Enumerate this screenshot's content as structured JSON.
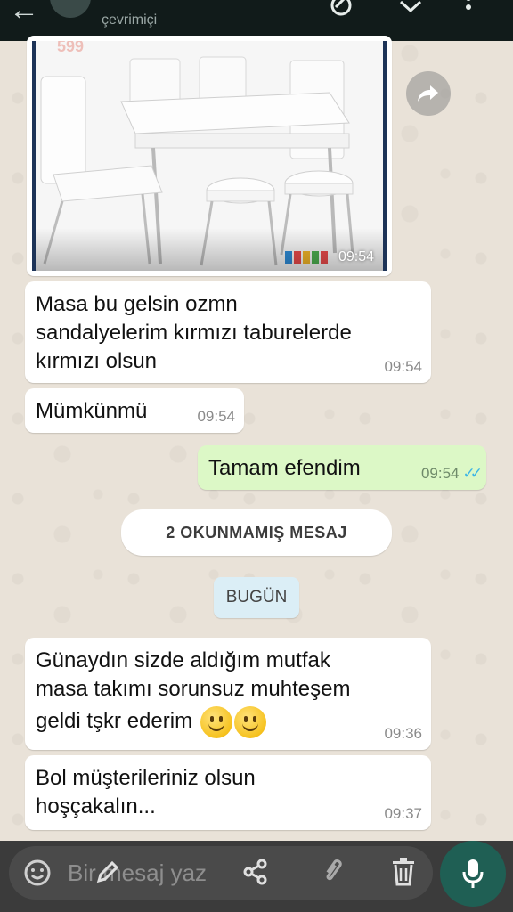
{
  "header": {
    "status": "çevrimiçi",
    "back_icon": "←"
  },
  "messages": {
    "image": {
      "time": "09:54",
      "price_fragment": "599"
    },
    "m1": {
      "line1": "Masa bu gelsin ozmn",
      "line2": "sandalyelerim kırmızı taburelerde",
      "line3": "kırmızı olsun",
      "time": "09:54"
    },
    "m2": {
      "text": "Mümkünmü",
      "time": "09:54"
    },
    "m3": {
      "text": "Tamam efendim",
      "time": "09:54",
      "ticks": "✓✓"
    },
    "unread": "2 OKUNMAMIŞ MESAJ",
    "date": "BUGÜN",
    "m4": {
      "line1": "Günaydın sizde aldığım mutfak",
      "line2": "masa takımı sorunsuz muhteşem",
      "line3": "geldi tşkr ederim",
      "time": "09:36"
    },
    "m5": {
      "line1": "Bol müşterileriniz olsun",
      "line2": "hoşçakalın...",
      "time": "09:37"
    }
  },
  "composer": {
    "placeholder": "Bir mesaj yaz"
  },
  "colors": {
    "header_bg": "#111b1a",
    "outgoing_bubble": "#dcf8c6",
    "incoming_bubble": "#ffffff",
    "read_ticks": "#3ab4e6",
    "mic_button": "#1f5f54"
  }
}
